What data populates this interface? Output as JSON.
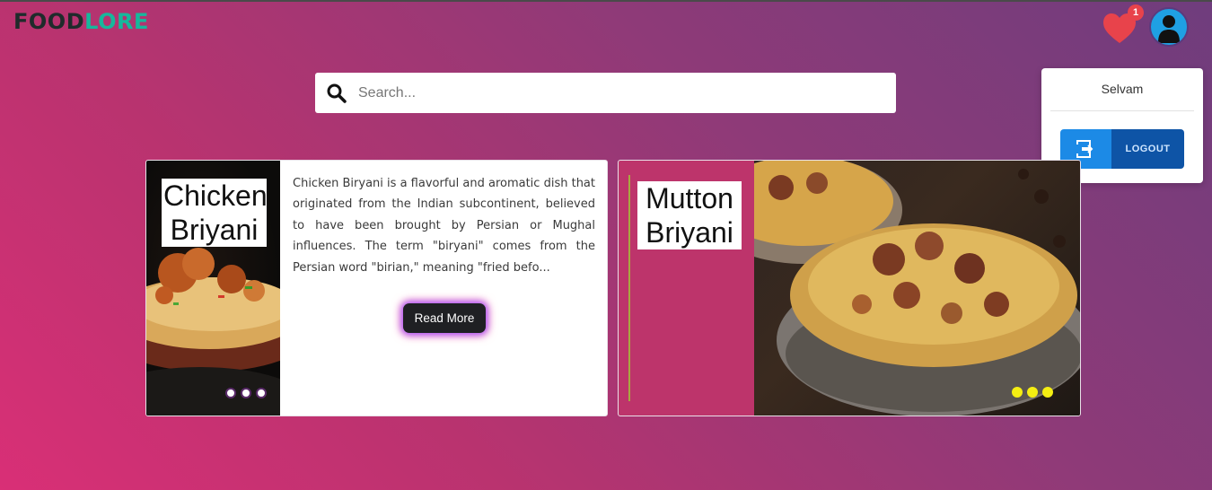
{
  "brand": {
    "part1": "FOOD",
    "part2": "LORE"
  },
  "header": {
    "favorites_count": "1"
  },
  "search": {
    "placeholder": "Search..."
  },
  "user_menu": {
    "username": "Selvam",
    "logout_label": "LOGOUT"
  },
  "cards": [
    {
      "title": "Chicken Briyani",
      "description": "Chicken Biryani is a flavorful and aromatic dish that originated from the Indian subcontinent, believed to have been brought by Persian or Mughal influences. The term \"biryani\" comes from the Persian word \"birian,\" meaning \"fried befo...",
      "button_label": "Read More"
    },
    {
      "title": "Mutton Briyani"
    }
  ],
  "colors": {
    "accent_green": "#16b89c",
    "heart": "#e8434b",
    "logout_blue": "#0e54a6",
    "dot_yellow": "#f5ee12"
  }
}
